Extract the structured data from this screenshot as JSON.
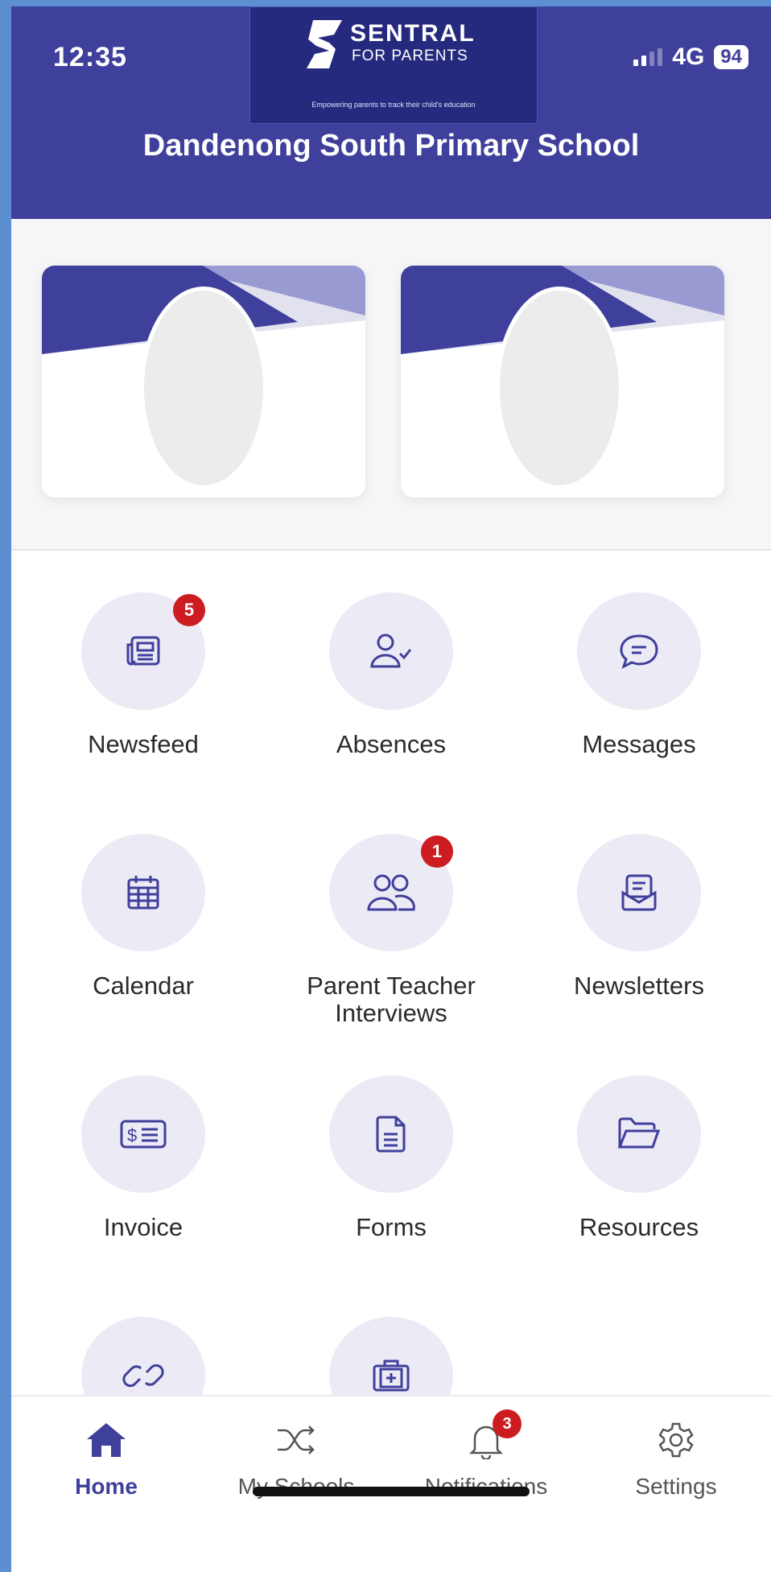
{
  "status_bar": {
    "time": "12:35",
    "network": "4G",
    "battery": "94"
  },
  "brand": {
    "name": "SENTRAL",
    "subtitle": "FOR PARENTS",
    "tagline": "Empowering parents to track their child's education"
  },
  "header": {
    "school_name": "Dandenong South Primary School"
  },
  "menu": {
    "newsfeed": {
      "label": "Newsfeed",
      "badge": "5",
      "icon": "newspaper-icon"
    },
    "absences": {
      "label": "Absences",
      "icon": "user-check-icon"
    },
    "messages": {
      "label": "Messages",
      "icon": "chat-bubble-icon"
    },
    "calendar": {
      "label": "Calendar",
      "icon": "calendar-icon"
    },
    "interviews": {
      "label_line1": "Parent Teacher",
      "label_line2": "Interviews",
      "badge": "1",
      "icon": "users-icon"
    },
    "newsletters": {
      "label": "Newsletters",
      "icon": "envelope-letter-icon"
    },
    "invoice": {
      "label": "Invoice",
      "icon": "invoice-icon"
    },
    "forms": {
      "label": "Forms",
      "icon": "document-icon"
    },
    "resources": {
      "label": "Resources",
      "icon": "folder-icon"
    }
  },
  "bottom_nav": {
    "home": "Home",
    "my_schools": "My Schools",
    "notifications": "Notifications",
    "notifications_badge": "3",
    "settings": "Settings"
  },
  "colors": {
    "primary": "#3f3f9c",
    "tile_bg": "#eceaf5",
    "badge": "#cc1c22"
  }
}
